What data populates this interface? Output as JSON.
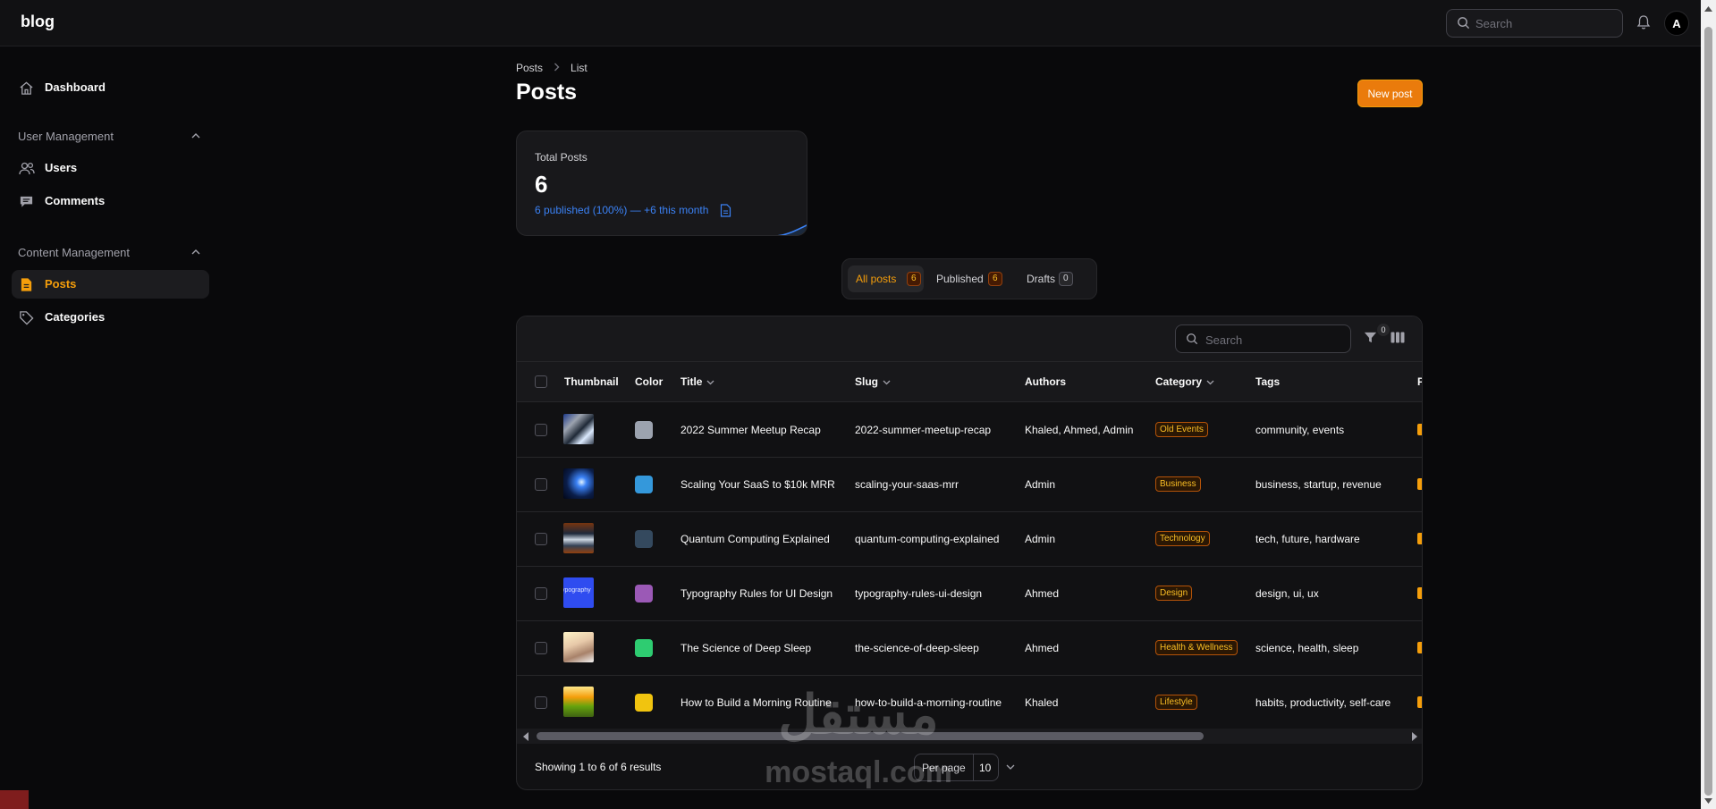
{
  "app": {
    "brand": "blog"
  },
  "topbar": {
    "search_placeholder": "Search",
    "avatar_initial": "A"
  },
  "sidebar": {
    "dashboard": "Dashboard",
    "groups": [
      {
        "label": "User Management",
        "items": [
          "Users",
          "Comments"
        ]
      },
      {
        "label": "Content Management",
        "items": [
          "Posts",
          "Categories"
        ]
      }
    ],
    "active": "Posts"
  },
  "breadcrumb": [
    "Posts",
    "List"
  ],
  "page": {
    "title": "Posts",
    "new_button": "New post"
  },
  "stats": {
    "label": "Total Posts",
    "value": "6",
    "description": "6 published (100%) — +6 this month",
    "accent": "#3b82f6"
  },
  "tabs": [
    {
      "label": "All posts",
      "count": "6",
      "active": true
    },
    {
      "label": "Published",
      "count": "6",
      "active": false
    },
    {
      "label": "Drafts",
      "count": "0",
      "active": false
    }
  ],
  "table": {
    "search_placeholder": "Search",
    "filter_count": "0",
    "columns": [
      "Thumbnail",
      "Color",
      "Title",
      "Slug",
      "Authors",
      "Category",
      "Tags",
      "P"
    ],
    "rows": [
      {
        "title": "2022 Summer Meetup Recap",
        "slug": "2022-summer-meetup-recap",
        "authors": "Khaled, Ahmed, Admin",
        "category": "Old Events",
        "tags": "community, events",
        "color": "#9ca3af"
      },
      {
        "title": "Scaling Your SaaS to $10k MRR",
        "slug": "scaling-your-saas-mrr",
        "authors": "Admin",
        "category": "Business",
        "tags": "business, startup, revenue",
        "color": "#3498db"
      },
      {
        "title": "Quantum Computing Explained",
        "slug": "quantum-computing-explained",
        "authors": "Admin",
        "category": "Technology",
        "tags": "tech, future, hardware",
        "color": "#34495e"
      },
      {
        "title": "Typography Rules for UI Design",
        "slug": "typography-rules-ui-design",
        "authors": "Ahmed",
        "category": "Design",
        "tags": "design, ui, ux",
        "color": "#9b59b6"
      },
      {
        "title": "The Science of Deep Sleep",
        "slug": "the-science-of-deep-sleep",
        "authors": "Ahmed",
        "category": "Health & Wellness",
        "tags": "science, health, sleep",
        "color": "#2ecc71"
      },
      {
        "title": "How to Build a Morning Routine",
        "slug": "how-to-build-a-morning-routine",
        "authors": "Khaled",
        "category": "Lifestyle",
        "tags": "habits, productivity, self-care",
        "color": "#f1c40f"
      }
    ],
    "thumb_texts": {
      "typography": "typography"
    },
    "footer": "Showing 1 to 6 of 6 results",
    "per_page_label": "Per page",
    "per_page_value": "10"
  },
  "watermark": {
    "arabic": "مستقل",
    "latin": "mostaql.com"
  },
  "colors": {
    "accent": "#f59e0b",
    "button": "#ea7b0c"
  }
}
